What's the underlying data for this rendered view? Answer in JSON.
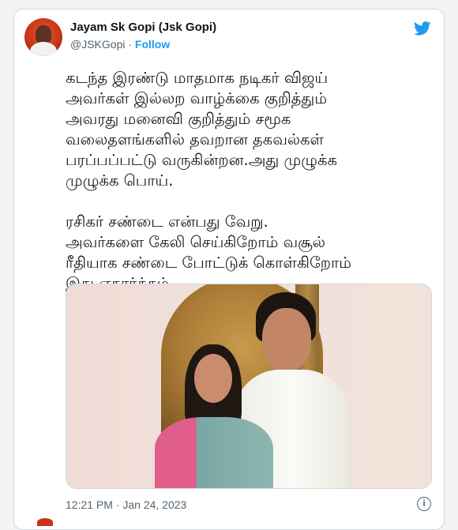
{
  "author": {
    "display_name": "Jayam Sk Gopi (Jsk Gopi)",
    "handle": "@JSKGopi",
    "separator": "·",
    "follow_label": "Follow"
  },
  "tweet": {
    "text": "கடந்த இரண்டு மாதமாக நடிகர் விஜய்\nஅவர்கள் இல்லற வாழ்க்கை குறித்தும்\nஅவரது மனைவி குறித்தும் சமூக\nவலைதளங்களில் தவறான தகவல்கள்\nபரப்பப்பட்டு வருகின்றன.அது முழுக்க\nமுழுக்க பொய்.\n\nரசிகர் சண்டை என்பது வேறு.\nஅவர்களை கேலி செய்கிறோம் வசூல்\nரீதியாக சண்டை போட்டுக் கொள்கிறோம்\nஇது எதார்த்தம்.",
    "timestamp": "12:21 PM · Jan 24, 2023"
  },
  "icons": {
    "brand": "twitter-bird-icon",
    "info": "info-icon",
    "brand_color": "#1d9bf0"
  }
}
